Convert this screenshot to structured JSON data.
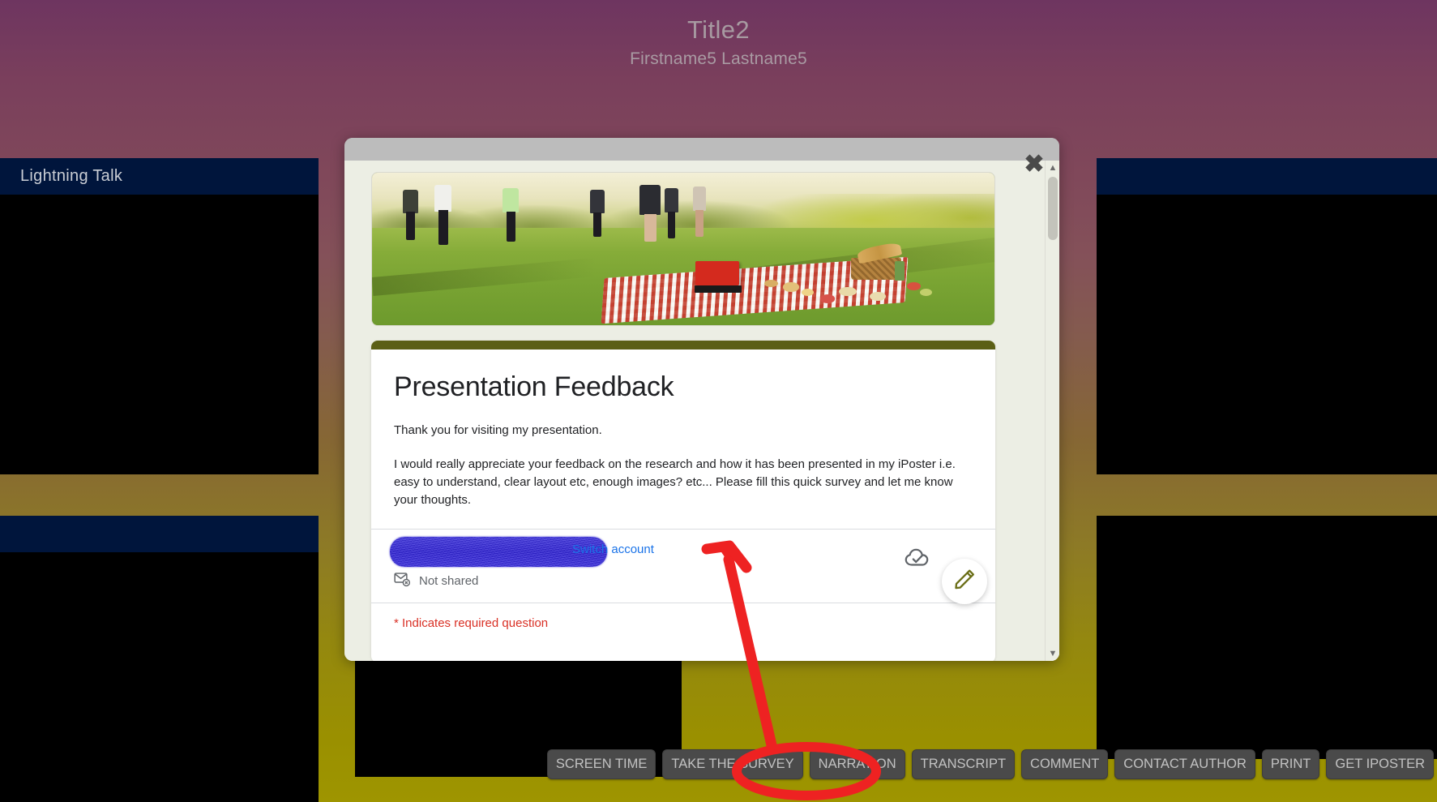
{
  "poster": {
    "title": "Title2",
    "author": "Firstname5 Lastname5",
    "panels": [
      {
        "id": "panel-tl",
        "label": "Lightning Talk"
      },
      {
        "id": "panel-bl",
        "label": ""
      },
      {
        "id": "panel-tr",
        "label": ""
      },
      {
        "id": "panel-br",
        "label": ""
      }
    ]
  },
  "modal": {
    "close_label": "✖",
    "scroll_up": "▲",
    "scroll_down": "▼",
    "feedback_tab_icon": "send-feedback-icon",
    "banner_alt": "picnic-banner-image"
  },
  "form": {
    "title": "Presentation Feedback",
    "paragraph1": "Thank you for visiting my presentation.",
    "paragraph2": "I would really appreciate your feedback on the research and how it has been presented in my iPoster i.e.  easy to understand, clear layout etc, enough images? etc... Please fill this quick survey and let me know your thoughts.",
    "account_email": "",
    "switch_account_label": "Switch account",
    "shared_status": "Not shared",
    "required_note": "* Indicates required question",
    "accent_color": "#5b5f15",
    "link_color": "#1a73e8",
    "required_color": "#d93025"
  },
  "toolbar": {
    "buttons": [
      {
        "label": "SCREEN TIME"
      },
      {
        "label": "TAKE THE SURVEY"
      },
      {
        "label": "NARRATION"
      },
      {
        "label": "TRANSCRIPT"
      },
      {
        "label": "COMMENT"
      },
      {
        "label": "CONTACT AUTHOR"
      },
      {
        "label": "PRINT"
      },
      {
        "label": "GET IPOSTER"
      }
    ],
    "highlighted_button": "TAKE THE SURVEY",
    "highlight_color": "#ee2222"
  },
  "annotation": {
    "arrow_color": "#ee2222",
    "ellipse_target": "TAKE THE SURVEY"
  }
}
